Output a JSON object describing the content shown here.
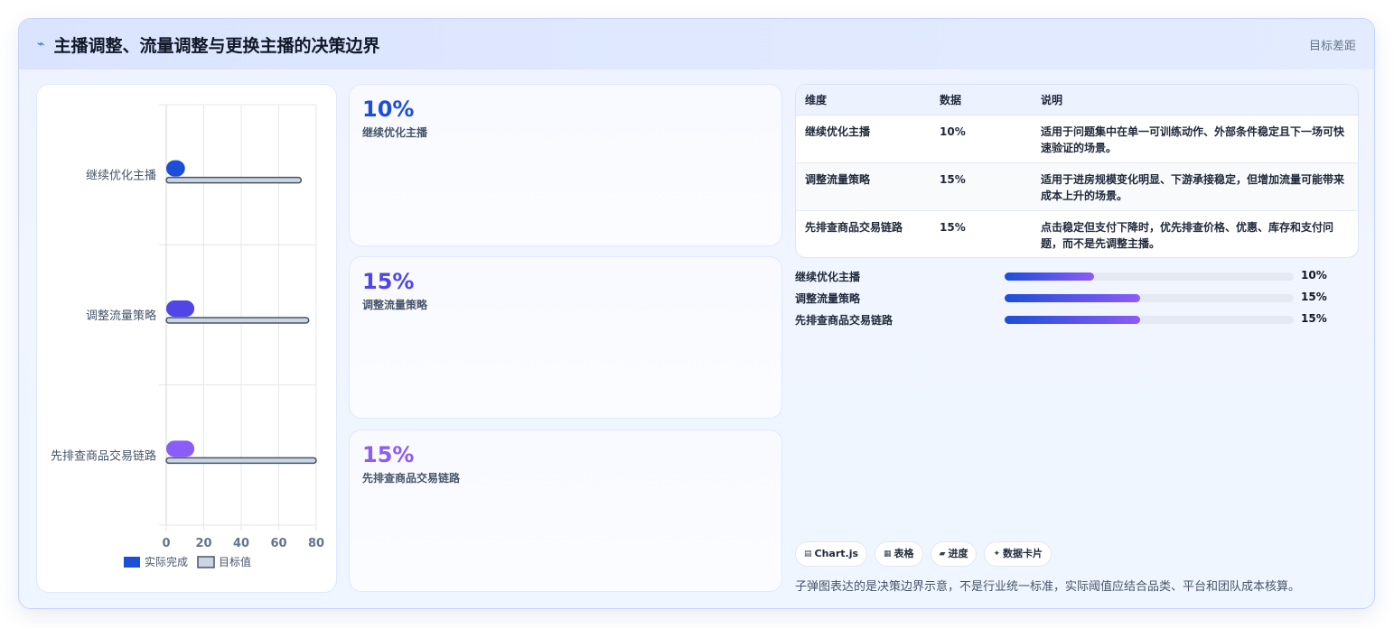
{
  "header": {
    "icon": "lightning-icon",
    "title": "主播调整、流量调整与更换主播的决策边界",
    "right_label": "目标差距"
  },
  "chart_data": {
    "type": "bar",
    "orientation": "horizontal",
    "categories": [
      "继续优化主播",
      "调整流量策略",
      "先排查商品交易链路"
    ],
    "series": [
      {
        "name": "实际完成",
        "values": [
          10,
          15,
          15
        ],
        "colors": [
          "#1d4ed8",
          "#4f46e5",
          "#8b5cf6"
        ]
      },
      {
        "name": "目标值",
        "values": [
          72,
          76,
          80
        ],
        "color": "#cbd5e1"
      }
    ],
    "xlim": [
      0,
      80
    ],
    "xticks": [
      "0",
      "20",
      "40",
      "60",
      "80"
    ],
    "grid": true,
    "legend_position": "bottom"
  },
  "kpis": [
    {
      "value": "10%",
      "label": "继续优化主播",
      "color": "#1d4ed8"
    },
    {
      "value": "15%",
      "label": "调整流量策略",
      "color": "#4f46e5"
    },
    {
      "value": "15%",
      "label": "先排查商品交易链路",
      "color": "#8b5cf6"
    }
  ],
  "table": {
    "headers": [
      "维度",
      "数据",
      "说明"
    ],
    "rows": [
      [
        "继续优化主播",
        "10%",
        "适用于问题集中在单一可训练动作、外部条件稳定且下一场可快速验证的场景。"
      ],
      [
        "调整流量策略",
        "15%",
        "适用于进房规模变化明显、下游承接稳定，但增加流量可能带来成本上升的场景。"
      ],
      [
        "先排查商品交易链路",
        "15%",
        "点击稳定但支付下降时，优先排查价格、优惠、库存和支付问题，而不是先调整主播。"
      ]
    ]
  },
  "progress": [
    {
      "label": "继续优化主播",
      "value_text": "10%",
      "fraction": 0.31
    },
    {
      "label": "调整流量策略",
      "value_text": "15%",
      "fraction": 0.47
    },
    {
      "label": "先排查商品交易链路",
      "value_text": "15%",
      "fraction": 0.47
    }
  ],
  "tags": [
    {
      "icon": "chart-icon",
      "glyph": "▤",
      "label": "Chart.js"
    },
    {
      "icon": "table-icon",
      "glyph": "▦",
      "label": "表格"
    },
    {
      "icon": "progress-icon",
      "glyph": "▰",
      "label": "进度"
    },
    {
      "icon": "sparkle-icon",
      "glyph": "✦",
      "label": "数据卡片"
    }
  ],
  "footnote": "子弹图表达的是决策边界示意，不是行业统一标准，实际阈值应结合品类、平台和团队成本核算。"
}
